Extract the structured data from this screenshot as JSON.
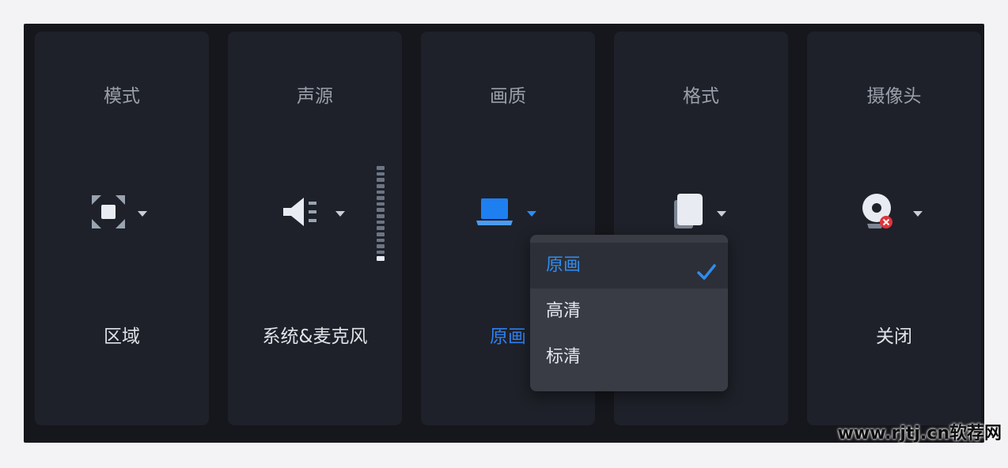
{
  "cards": [
    {
      "title": "模式",
      "value": "区域",
      "icon": "region-select-icon"
    },
    {
      "title": "声源",
      "value": "系统&麦克风",
      "icon": "speaker-icon"
    },
    {
      "title": "画质",
      "value": "原画",
      "icon": "laptop-quality-icon"
    },
    {
      "title": "格式",
      "value": "",
      "icon": "document-format-icon"
    },
    {
      "title": "摄像头",
      "value": "关闭",
      "icon": "webcam-off-icon"
    }
  ],
  "audio_meter": {
    "level": 0.06,
    "segments": 16
  },
  "quality_dropdown": {
    "options": [
      "原画",
      "高清",
      "标清"
    ],
    "selected": "原画"
  },
  "colors": {
    "accent": "#2f8cf0",
    "card_bg": "#1e2129",
    "frame_bg": "#15171c",
    "dropdown_bg": "#3a3c45",
    "error": "#e0333a"
  },
  "watermark": "www.rjtj.cn软荐网"
}
